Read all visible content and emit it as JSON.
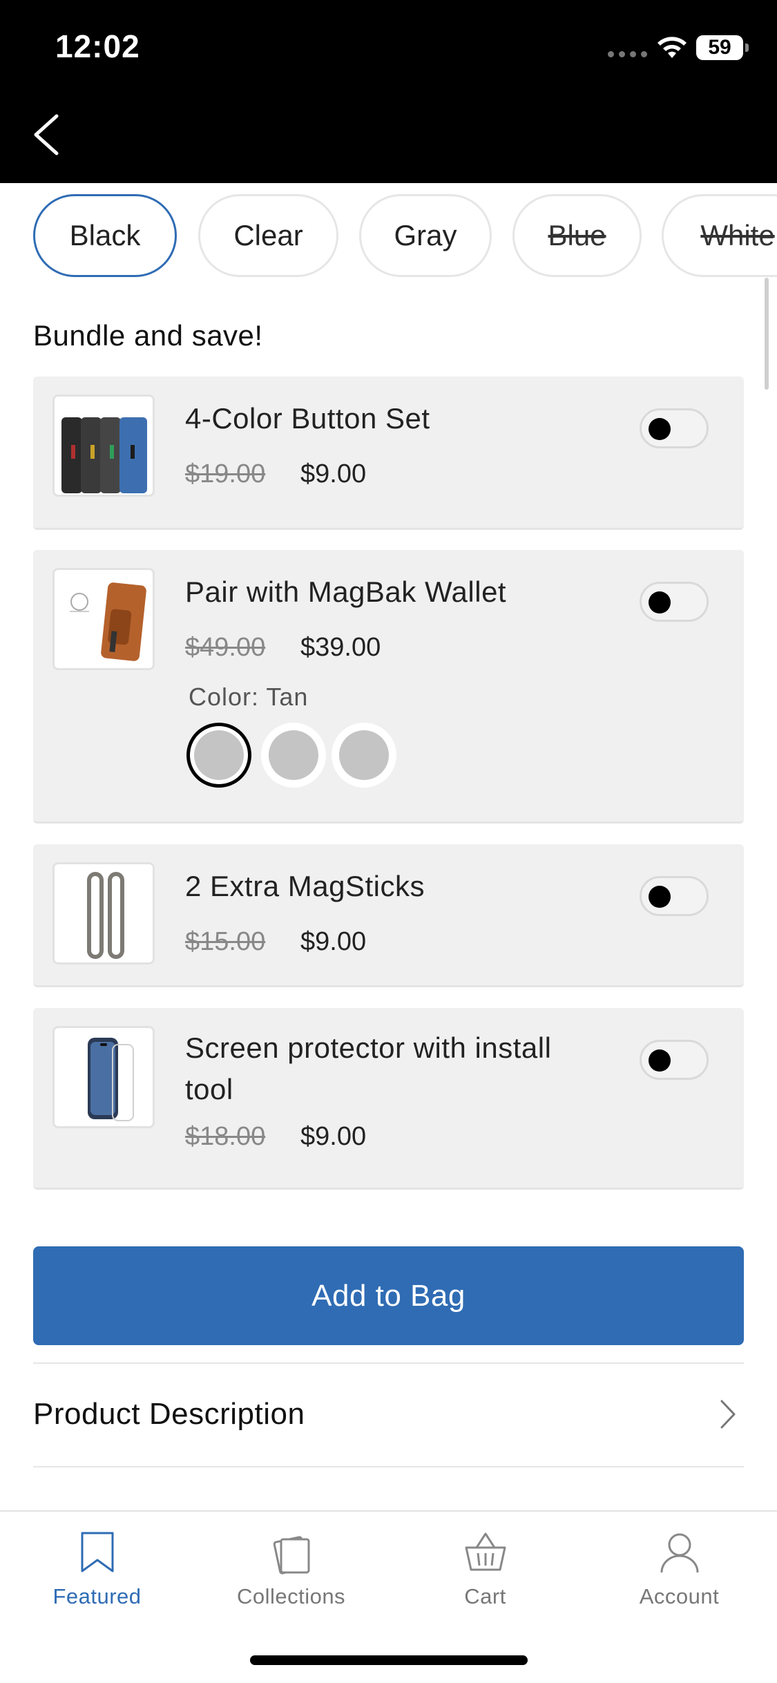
{
  "status_bar": {
    "time": "12:02",
    "battery": "59"
  },
  "colors": {
    "accent": "#2f6cb4",
    "card_bg": "#f0f0f0",
    "muted_text": "#888888"
  },
  "color_options": [
    {
      "label": "Black",
      "selected": true,
      "available": true
    },
    {
      "label": "Clear",
      "selected": false,
      "available": true
    },
    {
      "label": "Gray",
      "selected": false,
      "available": true
    },
    {
      "label": "Blue",
      "selected": false,
      "available": false
    },
    {
      "label": "White",
      "selected": false,
      "available": false
    }
  ],
  "bundle": {
    "title": "Bundle and save!",
    "items": [
      {
        "name": "4-Color Button Set",
        "old_price": "$19.00",
        "price": "$9.00",
        "enabled": false
      },
      {
        "name": "Pair with MagBak Wallet",
        "old_price": "$49.00",
        "price": "$39.00",
        "enabled": false,
        "color_label": "Color: Tan",
        "swatch_count": 3,
        "selected_swatch": 1
      },
      {
        "name": "2 Extra MagSticks",
        "old_price": "$15.00",
        "price": "$9.00",
        "enabled": false
      },
      {
        "name": "Screen protector with install tool",
        "old_price": "$18.00",
        "price": "$9.00",
        "enabled": false
      }
    ]
  },
  "add_to_bag": "Add to Bag",
  "product_description": "Product Description",
  "tabs": [
    {
      "label": "Featured",
      "icon": "bookmark-icon",
      "active": true
    },
    {
      "label": "Collections",
      "icon": "collections-icon",
      "active": false
    },
    {
      "label": "Cart",
      "icon": "basket-icon",
      "active": false
    },
    {
      "label": "Account",
      "icon": "person-icon",
      "active": false
    }
  ]
}
